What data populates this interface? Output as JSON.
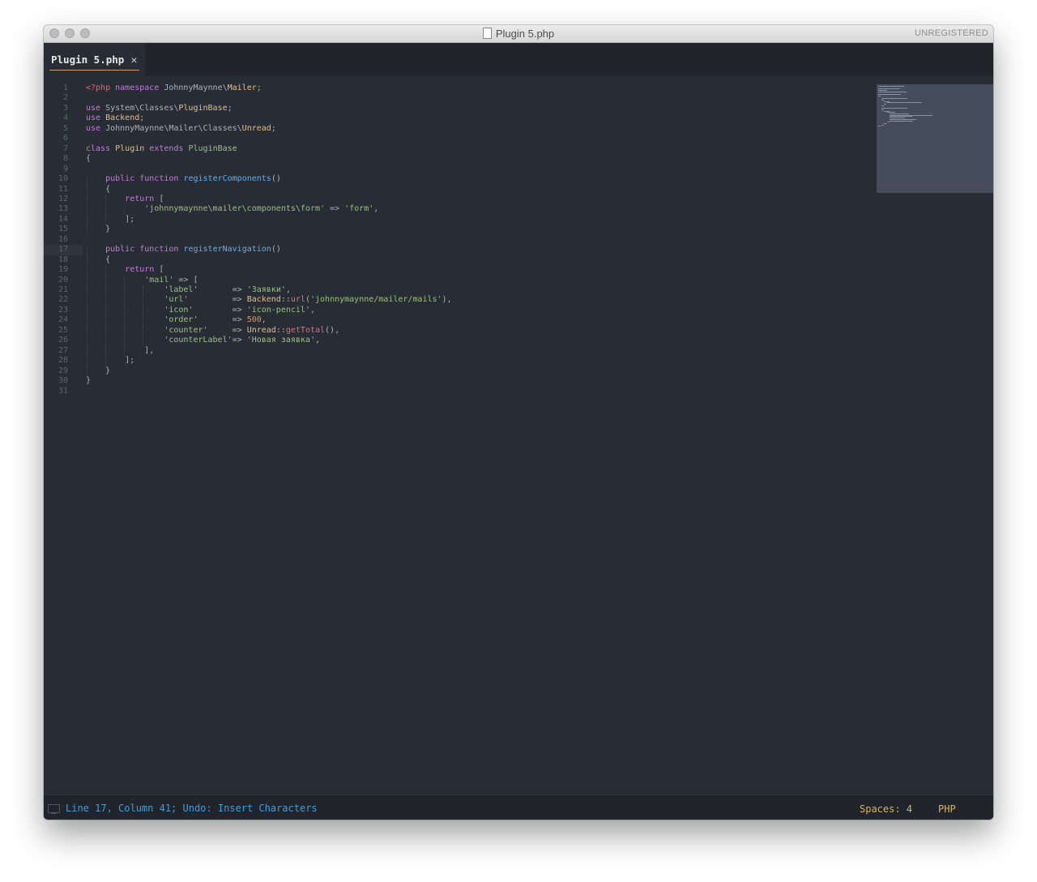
{
  "window": {
    "title": "Plugin 5.php",
    "registration": "UNREGISTERED"
  },
  "tabs": [
    {
      "label": "Plugin 5.php",
      "close_icon": "×",
      "active": true
    }
  ],
  "colors": {
    "tag": "#e06c75",
    "keyword": "#c678dd",
    "class": "#e5c07b",
    "function": "#61afef",
    "string": "#98c379",
    "number": "#d19a66",
    "plain": "#abb2bf",
    "method": "#e06c75",
    "status_text": "#3b9ede",
    "status_accent": "#d7b45b"
  },
  "editor": {
    "current_line": 17,
    "lines": [
      {
        "n": "1",
        "tokens": [
          {
            "t": "<?php",
            "c": "tag"
          },
          {
            "t": " "
          },
          {
            "t": "namespace",
            "c": "kw"
          },
          {
            "t": " JohnnyMaynne\\"
          },
          {
            "t": "Mailer",
            "c": "cls"
          },
          {
            "t": ";"
          }
        ]
      },
      {
        "n": "2",
        "tokens": []
      },
      {
        "n": "3",
        "tokens": [
          {
            "t": "use",
            "c": "kw"
          },
          {
            "t": " System\\Classes\\"
          },
          {
            "t": "PluginBase",
            "c": "cls"
          },
          {
            "t": ";"
          }
        ]
      },
      {
        "n": "4",
        "tokens": [
          {
            "t": "use",
            "c": "kw"
          },
          {
            "t": " "
          },
          {
            "t": "Backend",
            "c": "cls"
          },
          {
            "t": ";"
          }
        ]
      },
      {
        "n": "5",
        "tokens": [
          {
            "t": "use",
            "c": "kw"
          },
          {
            "t": " JohnnyMaynne\\Mailer\\Classes\\"
          },
          {
            "t": "Unread",
            "c": "cls"
          },
          {
            "t": ";"
          }
        ]
      },
      {
        "n": "6",
        "tokens": []
      },
      {
        "n": "7",
        "tokens": [
          {
            "t": "class",
            "c": "kw"
          },
          {
            "t": " "
          },
          {
            "t": "Plugin",
            "c": "cls"
          },
          {
            "t": " "
          },
          {
            "t": "extends",
            "c": "kw"
          },
          {
            "t": " "
          },
          {
            "t": "PluginBase",
            "c": "str"
          }
        ]
      },
      {
        "n": "8",
        "tokens": [
          {
            "t": "{"
          }
        ]
      },
      {
        "n": "9",
        "tokens": []
      },
      {
        "n": "10",
        "tokens": [
          {
            "t": "    "
          },
          {
            "t": "public",
            "c": "kw"
          },
          {
            "t": " "
          },
          {
            "t": "function",
            "c": "kw"
          },
          {
            "t": " "
          },
          {
            "t": "registerComponents",
            "c": "fn"
          },
          {
            "t": "()"
          }
        ]
      },
      {
        "n": "11",
        "tokens": [
          {
            "t": "    {"
          }
        ]
      },
      {
        "n": "12",
        "tokens": [
          {
            "t": "        "
          },
          {
            "t": "return",
            "c": "kw"
          },
          {
            "t": " ["
          }
        ]
      },
      {
        "n": "13",
        "tokens": [
          {
            "t": "            "
          },
          {
            "t": "'johnnymaynne\\mailer\\components\\form'",
            "c": "str"
          },
          {
            "t": " => "
          },
          {
            "t": "'form'",
            "c": "str"
          },
          {
            "t": ","
          }
        ]
      },
      {
        "n": "14",
        "tokens": [
          {
            "t": "        ];"
          }
        ]
      },
      {
        "n": "15",
        "tokens": [
          {
            "t": "    }"
          }
        ]
      },
      {
        "n": "16",
        "tokens": []
      },
      {
        "n": "17",
        "tokens": [
          {
            "t": "    "
          },
          {
            "t": "public",
            "c": "kw"
          },
          {
            "t": " "
          },
          {
            "t": "function",
            "c": "kw"
          },
          {
            "t": " "
          },
          {
            "t": "registerNavigation",
            "c": "fn"
          },
          {
            "t": "()"
          }
        ]
      },
      {
        "n": "18",
        "tokens": [
          {
            "t": "    {"
          }
        ]
      },
      {
        "n": "19",
        "tokens": [
          {
            "t": "        "
          },
          {
            "t": "return",
            "c": "kw"
          },
          {
            "t": " ["
          }
        ]
      },
      {
        "n": "20",
        "tokens": [
          {
            "t": "            "
          },
          {
            "t": "'mail'",
            "c": "str"
          },
          {
            "t": " => ["
          }
        ]
      },
      {
        "n": "21",
        "tokens": [
          {
            "t": "                "
          },
          {
            "t": "'label'",
            "c": "str"
          },
          {
            "t": "       => "
          },
          {
            "t": "'Заявки'",
            "c": "str"
          },
          {
            "t": ","
          }
        ]
      },
      {
        "n": "22",
        "tokens": [
          {
            "t": "                "
          },
          {
            "t": "'url'",
            "c": "str"
          },
          {
            "t": "         => "
          },
          {
            "t": "Backend",
            "c": "cls"
          },
          {
            "t": "::"
          },
          {
            "t": "url",
            "c": "meth"
          },
          {
            "t": "("
          },
          {
            "t": "'johnnymaynne/mailer/mails'",
            "c": "str"
          },
          {
            "t": "),"
          }
        ]
      },
      {
        "n": "23",
        "tokens": [
          {
            "t": "                "
          },
          {
            "t": "'icon'",
            "c": "str"
          },
          {
            "t": "        => "
          },
          {
            "t": "'icon-pencil'",
            "c": "str"
          },
          {
            "t": ","
          }
        ]
      },
      {
        "n": "24",
        "tokens": [
          {
            "t": "                "
          },
          {
            "t": "'order'",
            "c": "str"
          },
          {
            "t": "       => "
          },
          {
            "t": "500",
            "c": "num"
          },
          {
            "t": ","
          }
        ]
      },
      {
        "n": "25",
        "tokens": [
          {
            "t": "                "
          },
          {
            "t": "'counter'",
            "c": "str"
          },
          {
            "t": "     => "
          },
          {
            "t": "Unread",
            "c": "cls"
          },
          {
            "t": "::"
          },
          {
            "t": "getTotal",
            "c": "meth"
          },
          {
            "t": "(),"
          }
        ]
      },
      {
        "n": "26",
        "tokens": [
          {
            "t": "                "
          },
          {
            "t": "'counterLabel'",
            "c": "str"
          },
          {
            "t": "=> "
          },
          {
            "t": "'Новая заявка'",
            "c": "str"
          },
          {
            "t": ","
          }
        ]
      },
      {
        "n": "27",
        "tokens": [
          {
            "t": "            ],"
          }
        ]
      },
      {
        "n": "28",
        "tokens": [
          {
            "t": "        ];"
          }
        ]
      },
      {
        "n": "29",
        "tokens": [
          {
            "t": "    }"
          }
        ]
      },
      {
        "n": "30",
        "tokens": [
          {
            "t": "}"
          }
        ]
      },
      {
        "n": "31",
        "tokens": []
      }
    ]
  },
  "statusbar": {
    "panel_icon": "monitor-icon",
    "position_text": "Line 17, Column 41; Undo: Insert Characters",
    "indentation": "Spaces: 4",
    "syntax": "PHP"
  }
}
